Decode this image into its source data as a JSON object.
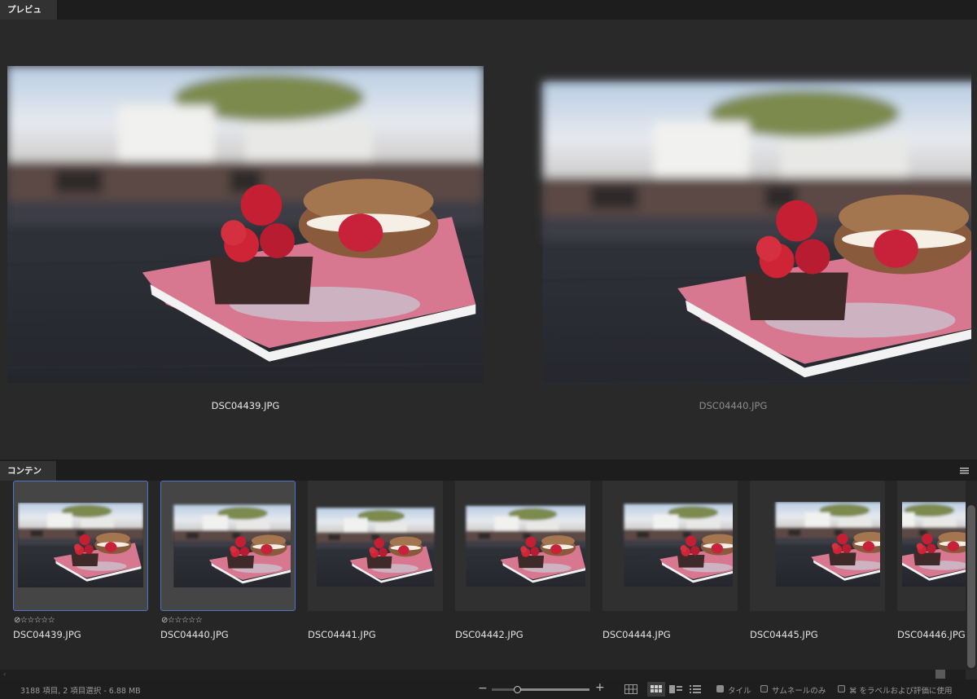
{
  "preview_panel": {
    "tab_label": "プレビュー",
    "images": [
      {
        "filename": "DSC04439.JPG",
        "selected": true
      },
      {
        "filename": "DSC04440.JPG",
        "selected": false
      }
    ]
  },
  "content_panel": {
    "tab_label": "コンテンツ",
    "menu_icon": "hamburger-menu-icon",
    "items": [
      {
        "filename": "DSC04439.JPG",
        "selected": true,
        "rating": "☆☆☆☆☆",
        "reject_icon": "⊘"
      },
      {
        "filename": "DSC04440.JPG",
        "selected": true,
        "rating": "☆☆☆☆☆",
        "reject_icon": "⊘"
      },
      {
        "filename": "DSC04441.JPG",
        "selected": false
      },
      {
        "filename": "DSC04442.JPG",
        "selected": false
      },
      {
        "filename": "DSC04444.JPG",
        "selected": false
      },
      {
        "filename": "DSC04445.JPG",
        "selected": false
      },
      {
        "filename": "DSC04446.JPG",
        "selected": false
      }
    ]
  },
  "status_bar": {
    "summary": "3188 項目, 2 項目選択 - 6.88 MB",
    "zoom_minus": "−",
    "zoom_plus": "+",
    "options": [
      {
        "label": "タイル",
        "checked": true
      },
      {
        "label": "サムネールのみ",
        "checked": false
      },
      {
        "label": "⌘ をラベルおよび評価に使用",
        "checked": false
      }
    ]
  },
  "colors": {
    "panel_bg": "#262626",
    "selection_border": "#4f74c8",
    "tab_active": "#323232"
  }
}
